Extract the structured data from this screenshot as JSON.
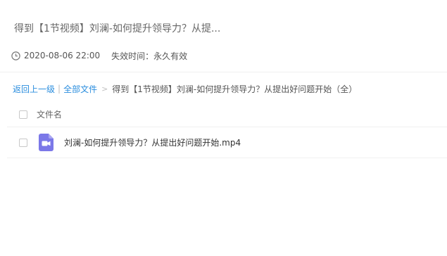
{
  "share": {
    "title": "得到【1节视频】刘澜-如何提升领导力？从提...",
    "created_at": "2020-08-06 22:00",
    "expire_label": "失效时间：永久有效"
  },
  "breadcrumb": {
    "back": "返回上一级",
    "separator": "|",
    "all_files": "全部文件",
    "arrow": ">",
    "current": "得到【1节视频】刘澜-如何提升领导力？从提出好问题开始（全）"
  },
  "file_list": {
    "header": "文件名",
    "files": [
      {
        "name": "刘澜-如何提升领导力？从提出好问题开始.mp4",
        "icon": "video-file-icon"
      }
    ]
  },
  "colors": {
    "link": "#2b8ede",
    "video_icon": "#7b78e8"
  }
}
